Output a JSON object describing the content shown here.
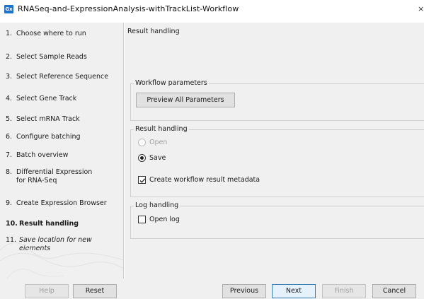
{
  "window": {
    "title": "RNASeq-and-ExpressionAnalysis-withTrackList-Workflow",
    "app_icon_text": "Gx",
    "close_glyph": "×"
  },
  "steps": [
    {
      "num": "1.",
      "label": "Choose where to run"
    },
    {
      "num": "2.",
      "label": "Select Sample Reads"
    },
    {
      "num": "3.",
      "label": "Select Reference Sequence"
    },
    {
      "num": "4.",
      "label": "Select Gene Track"
    },
    {
      "num": "5.",
      "label": "Select mRNA Track"
    },
    {
      "num": "6.",
      "label": "Configure batching"
    },
    {
      "num": "7.",
      "label": "Batch overview"
    },
    {
      "num": "8.",
      "label": "Differential Expression",
      "label2": "for RNA-Seq"
    },
    {
      "num": "9.",
      "label": "Create Expression Browser"
    },
    {
      "num": "10.",
      "label": "Result handling"
    },
    {
      "num": "11.",
      "label": "Save location for new",
      "label2": "elements"
    }
  ],
  "main": {
    "title": "Result handling",
    "workflow_parameters": {
      "legend": "Workflow parameters",
      "preview_button": "Preview All Parameters"
    },
    "result_handling": {
      "legend": "Result handling",
      "open_label": "Open",
      "save_label": "Save",
      "metadata_label": "Create workflow result metadata",
      "selected": "Save",
      "metadata_checked": true
    },
    "log_handling": {
      "legend": "Log handling",
      "open_log_label": "Open log",
      "open_log_checked": false
    }
  },
  "buttons": {
    "help": "Help",
    "reset": "Reset",
    "previous": "Previous",
    "next": "Next",
    "finish": "Finish",
    "cancel": "Cancel"
  }
}
